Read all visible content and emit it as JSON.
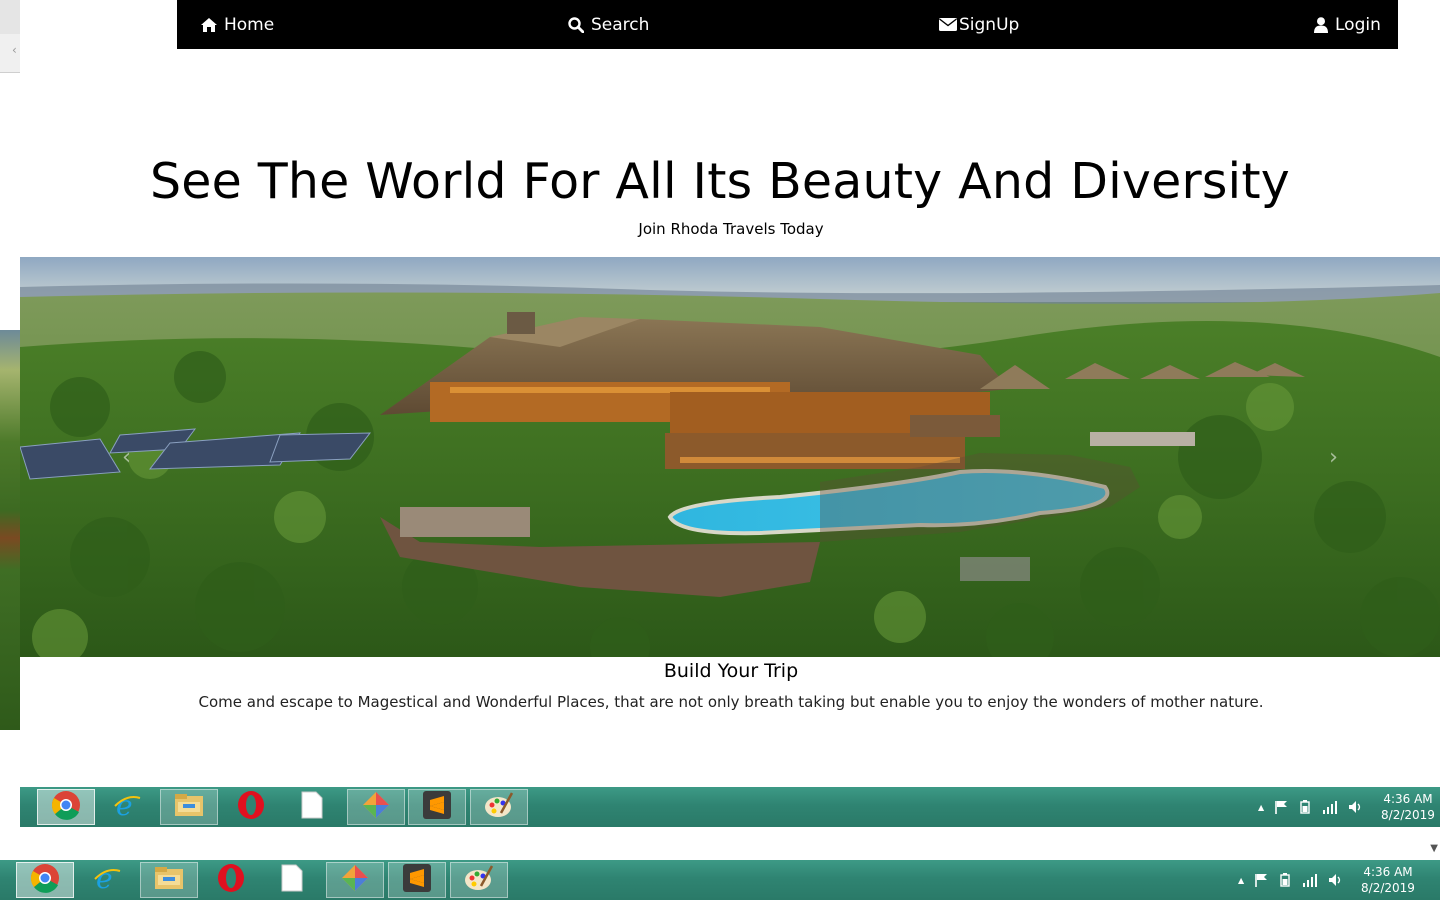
{
  "nav": {
    "home": "Home",
    "search": "Search",
    "signup": "SignUp",
    "login": "Login",
    "icons": [
      "home-icon",
      "search-icon",
      "envelope-icon",
      "user-icon"
    ]
  },
  "hero": {
    "title": "See The World For All Its Beauty And Diversity",
    "subtitle": "Join Rhoda Travels Today"
  },
  "carousel": {
    "prev_glyph": "‹",
    "next_glyph": "›",
    "caption_title": "Build Your Trip",
    "caption_text": "Come and escape to Magestical and Wonderful Places, that are not only breath taking but enable you to enjoy the wonders of mother nature."
  },
  "taskbar": {
    "apps": [
      "chrome",
      "internet-explorer",
      "file-explorer",
      "opera",
      "blank-document",
      "gimp-like-app",
      "sublime-text",
      "paint"
    ],
    "tray_up_glyph": "▲",
    "time": "4:36 AM",
    "date": "8/2/2019"
  },
  "colors": {
    "navbar_bg": "#000000",
    "taskbar": "#2f8472",
    "pool": "#2fb6df"
  }
}
